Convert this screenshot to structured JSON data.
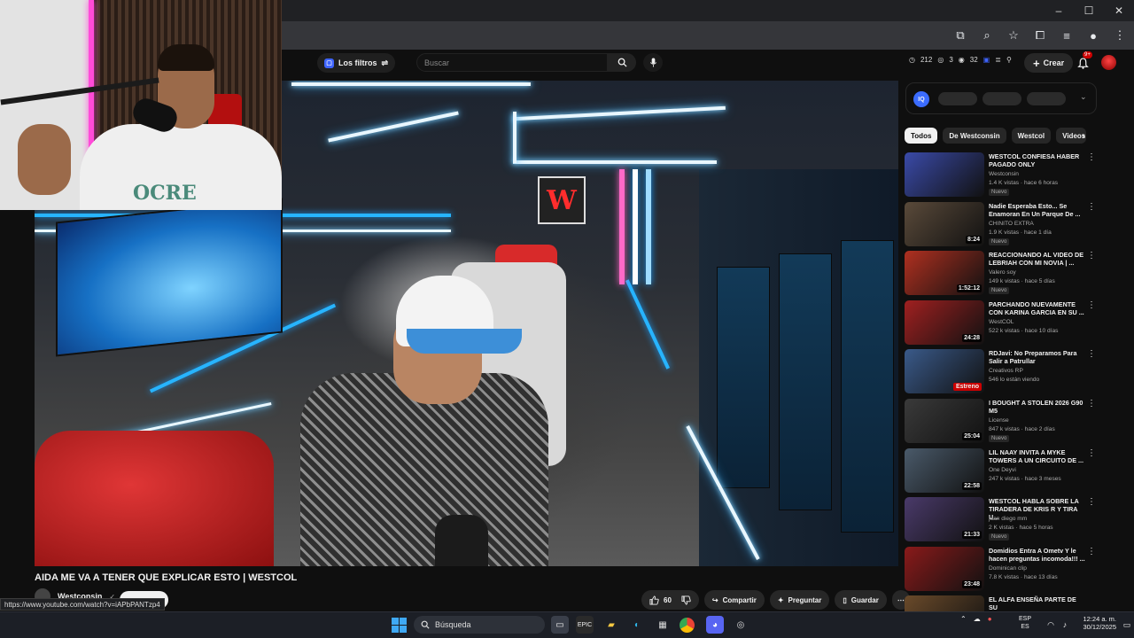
{
  "browser": {
    "window_controls": [
      "–",
      "☐",
      "✕"
    ]
  },
  "header": {
    "filters_label": "Los filtros",
    "search_placeholder": "Buscar",
    "stats": [
      "212",
      "3",
      "32"
    ],
    "create_label": "Crear",
    "notification_count": "9+"
  },
  "video": {
    "title": "AIDA ME VA A TENER QUE EXPLICAR ESTO | WESTCOL",
    "channel": "Westconsin",
    "likes": "60",
    "share_label": "Compartir",
    "ask_label": "Preguntar",
    "save_label": "Guardar",
    "wall_logo": "W",
    "shirt_print": "OCRE"
  },
  "status_url": "https://www.youtube.com/watch?v=iAPbPANTzp4",
  "sidebar": {
    "chips": [
      "Todos",
      "De Westconsin",
      "Westcol",
      "Videos re"
    ],
    "recommendations": [
      {
        "title": "WESTCOL CONFIESA HABER PAGADO ONLY",
        "channel": "Westconsin",
        "meta": "1.4 K vistas · hace 6 horas",
        "badge": "Nuevo",
        "duration": ""
      },
      {
        "title": "Nadie Esperaba Esto... Se Enamoran En Un Parque De ...",
        "channel": "CHINITO EXTRA",
        "meta": "1.9 K vistas · hace 1 día",
        "badge": "Nuevo",
        "duration": "8:24"
      },
      {
        "title": "REACCIONANDO AL VIDEO DE LEBRIAH CON MI NOVIA | ...",
        "channel": "Valero soy",
        "meta": "149 k vistas · hace 5 días",
        "badge": "Nuevo",
        "duration": "1:52:12"
      },
      {
        "title": "PARCHANDO NUEVAMENTE CON KARINA GARCIA EN SU ...",
        "channel": "WestCOL",
        "meta": "522 k vistas · hace 10 días",
        "badge": "",
        "duration": "24:28"
      },
      {
        "title": "RDJavi: No Preparamos Para Salir a Patrullar",
        "channel": "Creativos RP",
        "meta": "546 lo están viendo",
        "badge": "",
        "duration": "Estreno"
      },
      {
        "title": "I BOUGHT A STOLEN 2026 G90 M5",
        "channel": "License",
        "meta": "847 k vistas · hace 2 días",
        "badge": "Nuevo",
        "duration": "25:04"
      },
      {
        "title": "LIL NAAY INVITA A MYKE TOWERS A UN CIRCUITO DE ...",
        "channel": "One Deyvi",
        "meta": "247 k vistas · hace 3 meses",
        "badge": "",
        "duration": "22:58"
      },
      {
        "title": "WESTCOL HABLA SOBRE LA TIRADERA DE KRIS R Y TIRA U...",
        "channel": "juan diego mm",
        "meta": "2 K vistas · hace 5 horas",
        "badge": "Nuevo",
        "duration": "21:33"
      },
      {
        "title": "Domidios Entra A Ometv Y le hacen preguntas incomoda!!! ...",
        "channel": "Dominican clip",
        "meta": "7.8 K vistas · hace 13 días",
        "badge": "",
        "duration": "23:48"
      },
      {
        "title": "EL ALFA ENSEÑA PARTE DE SU",
        "channel": "",
        "meta": "",
        "badge": "",
        "duration": ""
      }
    ],
    "thumb_colors": [
      "#3a4aa8",
      "#5a4a3a",
      "#b03020",
      "#a02020",
      "#3a5a8a",
      "#3a3a3a",
      "#4a5a6a",
      "#4a3a6a",
      "#8a1a1a",
      "#6a4a2a"
    ]
  },
  "taskbar": {
    "search_label": "Búsqueda",
    "lang_top": "ESP",
    "lang_bottom": "ES",
    "time": "12:24 a. m.",
    "date": "30/12/2025"
  }
}
